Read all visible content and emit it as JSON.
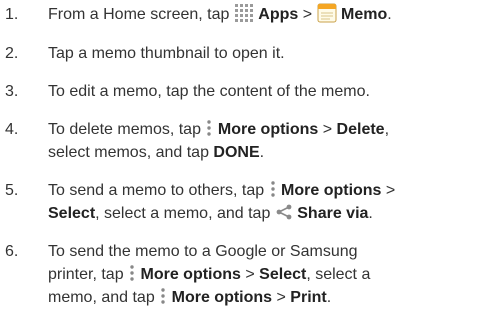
{
  "steps": [
    {
      "number": "1.",
      "t1": "From a Home screen, tap ",
      "apps_label": "Apps",
      "sep": " > ",
      "memo_label": "Memo",
      "end": "."
    },
    {
      "number": "2.",
      "text": "Tap a memo thumbnail to open it."
    },
    {
      "number": "3.",
      "text": "To edit a memo, tap the content of the memo."
    },
    {
      "number": "4.",
      "t1": "To delete memos, tap ",
      "more_options": "More options",
      "sep": " > ",
      "delete_label": "Delete",
      "comma": ",",
      "t2": "select memos, and tap ",
      "done_label": "DONE",
      "end": "."
    },
    {
      "number": "5.",
      "t1": "To send a memo to others, tap ",
      "more_options": "More options",
      "sep": " >",
      "select_label": "Select",
      "t2": ", select a memo, and tap ",
      "share_label": "Share via",
      "end": "."
    },
    {
      "number": "6.",
      "line1": "To send the memo to a Google or Samsung",
      "t1": "printer, tap ",
      "more_options": "More options",
      "sep": " > ",
      "select_label": "Select",
      "t2": ", select a",
      "t3": "memo, and tap ",
      "more_options_2": "More options",
      "sep2": " > ",
      "print_label": "Print",
      "end": "."
    }
  ],
  "icons": {
    "apps": "apps-grid-icon",
    "memo": "memo-app-icon",
    "more_options": "more-options-icon",
    "share": "share-icon"
  },
  "colors": {
    "text": "#333333",
    "bold": "#222222",
    "apps_icon": "#9a9a9a",
    "memo_icon_top": "#f5a623",
    "share_icon": "#8a8a8a"
  }
}
